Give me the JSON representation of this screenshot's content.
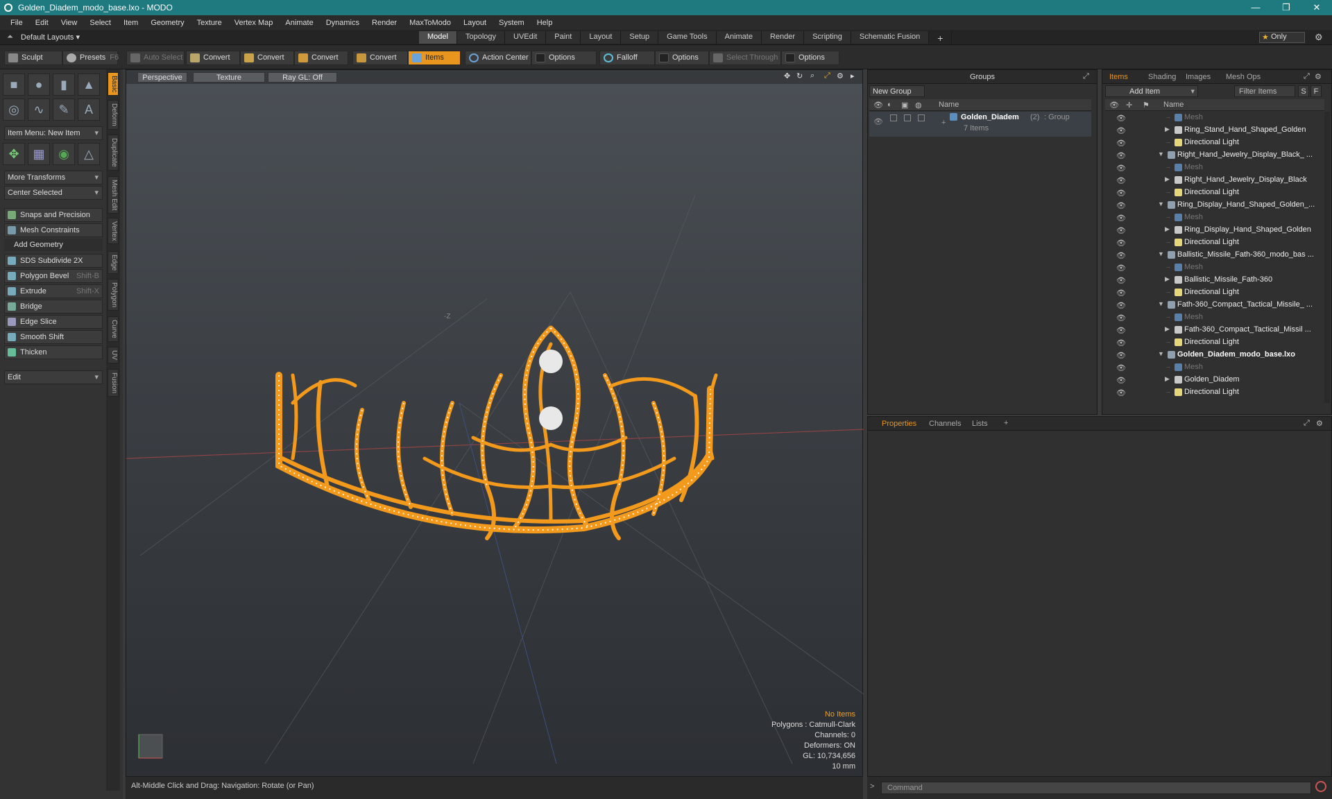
{
  "title": "Golden_Diadem_modo_base.lxo - MODO",
  "window_buttons": [
    "—",
    "❐",
    "✕"
  ],
  "menu": [
    "File",
    "Edit",
    "View",
    "Select",
    "Item",
    "Geometry",
    "Texture",
    "Vertex Map",
    "Animate",
    "Dynamics",
    "Render",
    "MaxToModo",
    "Layout",
    "System",
    "Help"
  ],
  "layout_bar": {
    "layouts": "Default Layouts ▾",
    "tabs": [
      "Model",
      "Topology",
      "UVEdit",
      "Paint",
      "Layout",
      "Setup",
      "Game Tools",
      "Animate",
      "Render",
      "Scripting",
      "Schematic Fusion"
    ],
    "active_tab": "Model",
    "add": "+",
    "only": "Only"
  },
  "toolbar": {
    "sculpt": "Sculpt",
    "presets": "Presets",
    "presets_key": "F6",
    "auto_select": "Auto Select",
    "convert": "Convert",
    "items": "Items",
    "action_center": "Action Center",
    "options": "Options",
    "falloff": "Falloff",
    "select_through": "Select Through"
  },
  "left_panel": {
    "item_menu": "Item Menu: New Item",
    "more_transforms": "More Transforms",
    "center_selected": "Center Selected",
    "snaps": "Snaps and Precision",
    "mesh_constraints": "Mesh Constraints",
    "add_geometry": "Add Geometry",
    "tools": [
      {
        "label": "SDS Subdivide 2X",
        "shortcut": ""
      },
      {
        "label": "Polygon Bevel",
        "shortcut": "Shift-B"
      },
      {
        "label": "Extrude",
        "shortcut": "Shift-X"
      },
      {
        "label": "Bridge",
        "shortcut": ""
      },
      {
        "label": "Edge Slice",
        "shortcut": ""
      },
      {
        "label": "Smooth Shift",
        "shortcut": ""
      },
      {
        "label": "Thicken",
        "shortcut": ""
      }
    ],
    "edit": "Edit"
  },
  "side_tabs": [
    "Basic",
    "Deform",
    "Duplicate",
    "Mesh Edit",
    "Vertex",
    "Edge",
    "Polygon",
    "Curve",
    "UV",
    "Fusion"
  ],
  "viewport": {
    "perspective": "Perspective",
    "texture": "Texture",
    "raygl": "Ray GL: Off",
    "axis_label": "-Z",
    "info": {
      "no_items": "No Items",
      "polygons": "Polygons : Catmull-Clark",
      "channels": "Channels: 0",
      "deformers": "Deformers: ON",
      "gl": "GL: 10,734,656",
      "scale": "10 mm"
    }
  },
  "status_bar": "Alt-Middle Click and Drag:   Navigation: Rotate (or Pan)",
  "groups_panel": {
    "title": "Groups",
    "new_group": "New Group",
    "name_col": "Name",
    "group_name": "Golden_Diadem",
    "group_count": "(2)",
    "group_type": ": Group",
    "group_items": "7 Items"
  },
  "items_panel": {
    "tabs": [
      "Items",
      "Shading",
      "Images",
      "Mesh Ops"
    ],
    "add_item": "Add Item",
    "filter": "Filter Items",
    "s_btn": "S",
    "f_btn": "F",
    "name_col": "Name",
    "rows": [
      {
        "level": 2,
        "type": "mesh",
        "label": "Mesh",
        "dim": true,
        "tri": ""
      },
      {
        "level": 2,
        "type": "locator",
        "label": "Ring_Stand_Hand_Shaped_Golden",
        "tri": "▶"
      },
      {
        "level": 2,
        "type": "light",
        "label": "Directional Light",
        "tri": ""
      },
      {
        "level": 1,
        "type": "scene",
        "label": "Right_Hand_Jewelry_Display_Black_ ...",
        "tri": "▼"
      },
      {
        "level": 2,
        "type": "mesh",
        "label": "Mesh",
        "dim": true,
        "tri": ""
      },
      {
        "level": 2,
        "type": "locator",
        "label": "Right_Hand_Jewelry_Display_Black",
        "tri": "▶"
      },
      {
        "level": 2,
        "type": "light",
        "label": "Directional Light",
        "tri": ""
      },
      {
        "level": 1,
        "type": "scene",
        "label": "Ring_Display_Hand_Shaped_Golden_...",
        "tri": "▼"
      },
      {
        "level": 2,
        "type": "mesh",
        "label": "Mesh",
        "dim": true,
        "tri": ""
      },
      {
        "level": 2,
        "type": "locator",
        "label": "Ring_Display_Hand_Shaped_Golden",
        "tri": "▶"
      },
      {
        "level": 2,
        "type": "light",
        "label": "Directional Light",
        "tri": ""
      },
      {
        "level": 1,
        "type": "scene",
        "label": "Ballistic_Missile_Fath-360_modo_bas ...",
        "tri": "▼"
      },
      {
        "level": 2,
        "type": "mesh",
        "label": "Mesh",
        "dim": true,
        "tri": ""
      },
      {
        "level": 2,
        "type": "locator",
        "label": "Ballistic_Missile_Fath-360",
        "tri": "▶"
      },
      {
        "level": 2,
        "type": "light",
        "label": "Directional Light",
        "tri": ""
      },
      {
        "level": 1,
        "type": "scene",
        "label": "Fath-360_Compact_Tactical_Missile_ ...",
        "tri": "▼"
      },
      {
        "level": 2,
        "type": "mesh",
        "label": "Mesh",
        "dim": true,
        "tri": ""
      },
      {
        "level": 2,
        "type": "locator",
        "label": "Fath-360_Compact_Tactical_Missil ...",
        "tri": "▶"
      },
      {
        "level": 2,
        "type": "light",
        "label": "Directional Light",
        "tri": ""
      },
      {
        "level": 1,
        "type": "scene",
        "label": "Golden_Diadem_modo_base.lxo",
        "bold": true,
        "tri": "▼"
      },
      {
        "level": 2,
        "type": "mesh",
        "label": "Mesh",
        "dim": true,
        "tri": ""
      },
      {
        "level": 2,
        "type": "locator",
        "label": "Golden_Diadem",
        "tri": "▶"
      },
      {
        "level": 2,
        "type": "light",
        "label": "Directional Light",
        "tri": ""
      }
    ]
  },
  "props_tabs": [
    "Properties",
    "Channels",
    "Lists"
  ],
  "command_placeholder": "Command",
  "colors": {
    "accent": "#e8961e",
    "title": "#1f7a80",
    "diadem": "#f39a1c"
  }
}
